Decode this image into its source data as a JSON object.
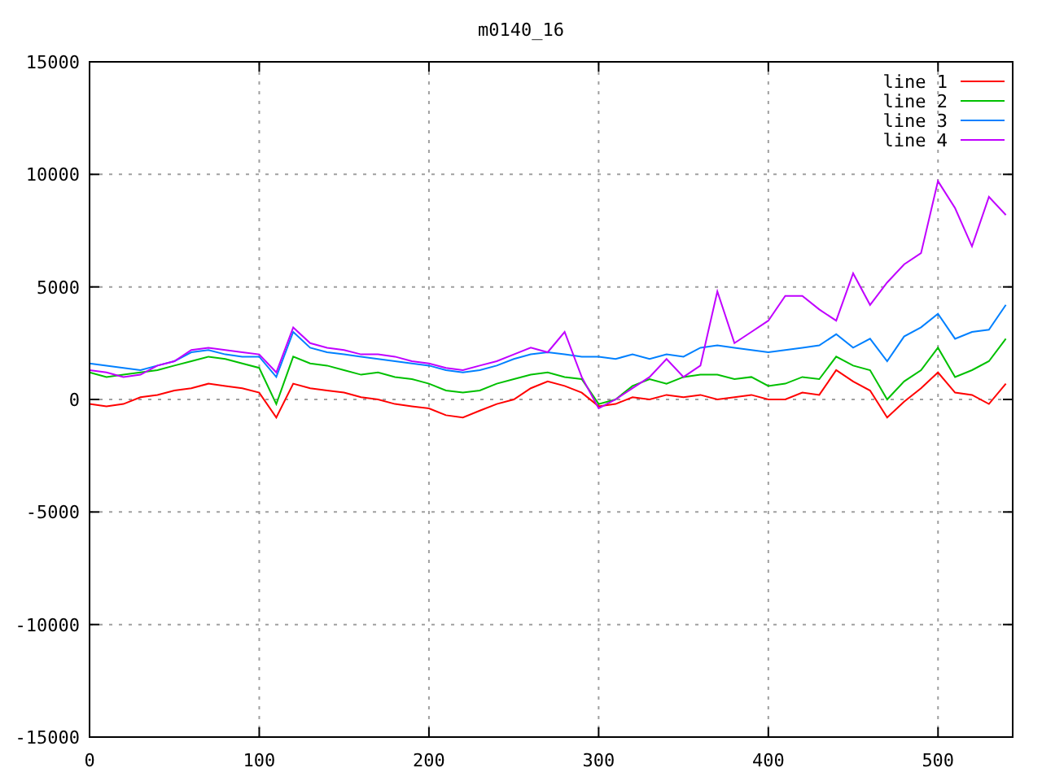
{
  "chart_data": {
    "type": "line",
    "title": "m0140_16",
    "x": [
      0,
      10,
      20,
      30,
      40,
      50,
      60,
      70,
      80,
      90,
      100,
      110,
      120,
      130,
      140,
      150,
      160,
      170,
      180,
      190,
      200,
      210,
      220,
      230,
      240,
      250,
      260,
      270,
      280,
      290,
      300,
      310,
      320,
      330,
      340,
      350,
      360,
      370,
      380,
      390,
      400,
      410,
      420,
      430,
      440,
      450,
      460,
      470,
      480,
      490,
      500,
      510,
      520,
      530,
      540
    ],
    "series": [
      {
        "name": "line 1",
        "color": "#ff0000",
        "values": [
          -200,
          -300,
          -200,
          100,
          200,
          400,
          500,
          700,
          600,
          500,
          300,
          -800,
          700,
          500,
          400,
          300,
          100,
          0,
          -200,
          -300,
          -400,
          -700,
          -800,
          -500,
          -200,
          0,
          500,
          800,
          600,
          300,
          -300,
          -200,
          100,
          0,
          200,
          100,
          200,
          0,
          100,
          200,
          0,
          0,
          300,
          200,
          1300,
          800,
          400,
          -800,
          -100,
          500,
          1200,
          300,
          200,
          -200,
          700
        ]
      },
      {
        "name": "line 2",
        "color": "#00c000",
        "values": [
          1200,
          1000,
          1100,
          1200,
          1300,
          1500,
          1700,
          1900,
          1800,
          1600,
          1400,
          -200,
          1900,
          1600,
          1500,
          1300,
          1100,
          1200,
          1000,
          900,
          700,
          400,
          300,
          400,
          700,
          900,
          1100,
          1200,
          1000,
          900,
          -200,
          0,
          600,
          900,
          700,
          1000,
          1100,
          1100,
          900,
          1000,
          600,
          700,
          1000,
          900,
          1900,
          1500,
          1300,
          0,
          800,
          1300,
          2300,
          1000,
          1300,
          1700,
          2700
        ]
      },
      {
        "name": "line 3",
        "color": "#0080ff",
        "values": [
          1600,
          1500,
          1400,
          1300,
          1500,
          1700,
          2100,
          2200,
          2000,
          1900,
          1900,
          1000,
          3000,
          2300,
          2100,
          2000,
          1900,
          1800,
          1700,
          1600,
          1500,
          1300,
          1200,
          1300,
          1500,
          1800,
          2000,
          2100,
          2000,
          1900,
          1900,
          1800,
          2000,
          1800,
          2000,
          1900,
          2300,
          2400,
          2300,
          2200,
          2100,
          2200,
          2300,
          2400,
          2900,
          2300,
          2700,
          1700,
          2800,
          3200,
          3800,
          2700,
          3000,
          3100,
          4200
        ]
      },
      {
        "name": "line 4",
        "color": "#c000ff",
        "values": [
          1300,
          1200,
          1000,
          1100,
          1500,
          1700,
          2200,
          2300,
          2200,
          2100,
          2000,
          1200,
          3200,
          2500,
          2300,
          2200,
          2000,
          2000,
          1900,
          1700,
          1600,
          1400,
          1300,
          1500,
          1700,
          2000,
          2300,
          2100,
          3000,
          1000,
          -400,
          0,
          500,
          1000,
          1800,
          1000,
          1500,
          4800,
          2500,
          3000,
          3500,
          4600,
          4600,
          4000,
          3500,
          5600,
          4200,
          5200,
          6000,
          6500,
          9700,
          8500,
          6800,
          9000,
          8200
        ]
      }
    ],
    "grid": true,
    "legend": true,
    "xlim": [
      0,
      544
    ],
    "ylim": [
      -15000,
      15000
    ],
    "xticks": [
      0,
      100,
      200,
      300,
      400,
      500
    ],
    "yticks": [
      -15000,
      -10000,
      -5000,
      0,
      5000,
      10000,
      15000
    ]
  }
}
